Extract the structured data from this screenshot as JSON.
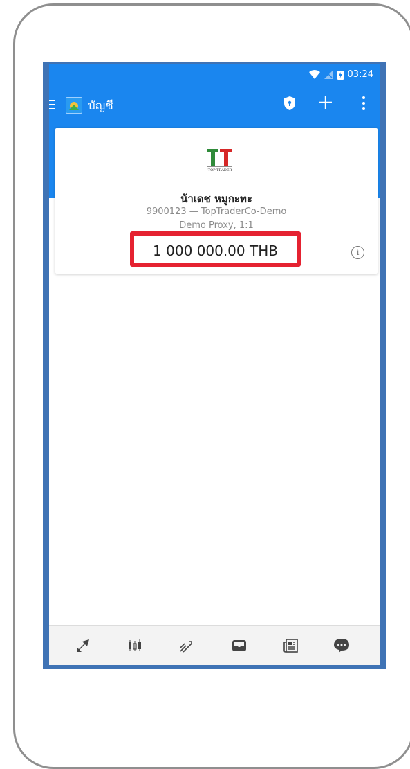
{
  "status_bar": {
    "time": "03:24",
    "icons": [
      "wifi-icon",
      "no-signal-icon",
      "battery-charging-icon"
    ]
  },
  "app_bar": {
    "title": "บัญชี",
    "icons": [
      "menu-icon",
      "app-logo",
      "shield-icon",
      "plus-icon",
      "more-vert-icon"
    ]
  },
  "account_card": {
    "broker_logo_text": "TOP TRADER",
    "name": "น้าเดช หมูกะทะ",
    "login_server": "9900123 — TopTraderCo-Demo",
    "type_leverage": "Demo Proxy, 1:1",
    "balance": "1 000 000.00 THB",
    "info_icon": "i"
  },
  "bottom_nav": {
    "items": [
      "quotes-icon",
      "chart-candles-icon",
      "trade-icon",
      "history-inbox-icon",
      "news-icon",
      "chat-icon"
    ]
  },
  "colors": {
    "accent": "#1a86ef",
    "highlight_border": "#e52231",
    "frame_blue": "#3f73b5"
  }
}
